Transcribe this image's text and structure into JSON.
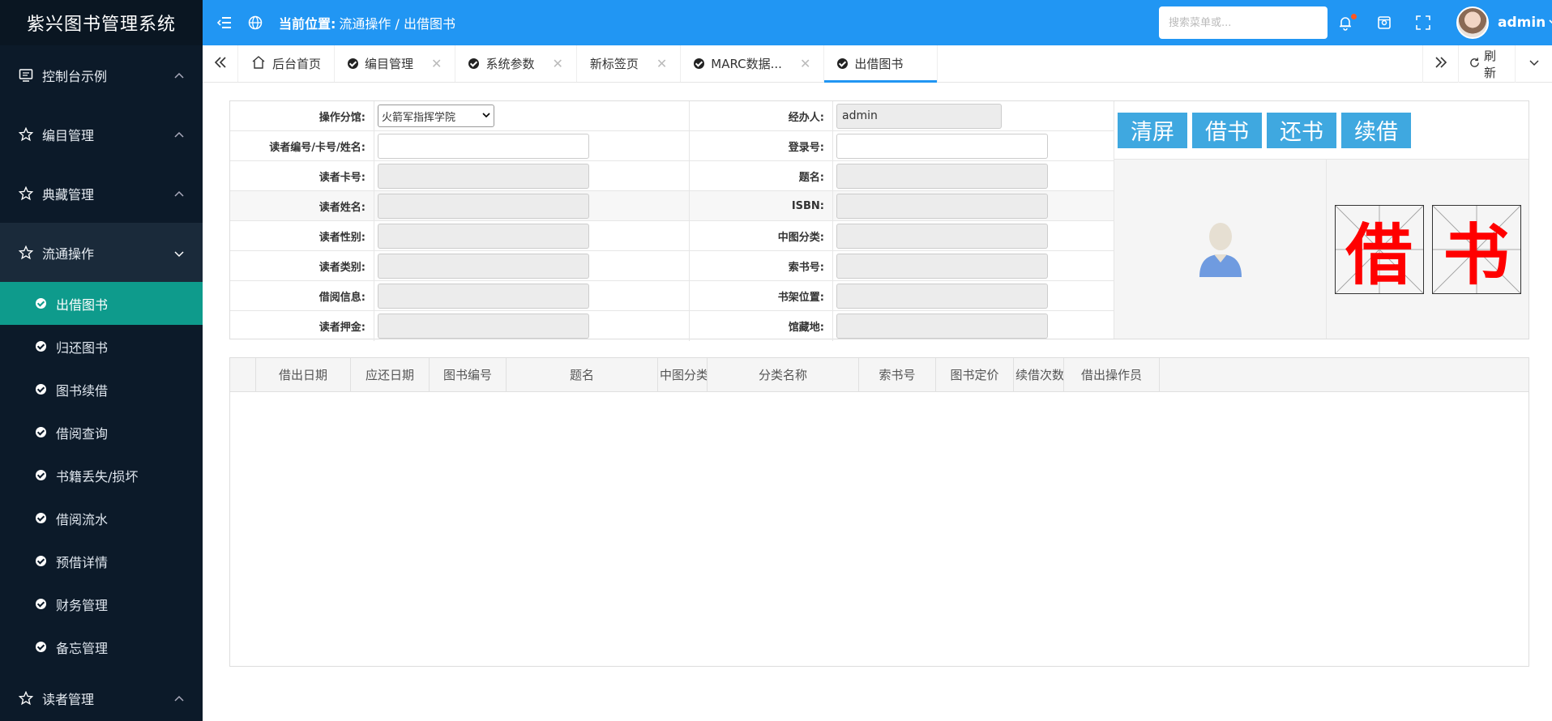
{
  "app": {
    "title": "紫兴图书管理系统"
  },
  "sidebar": {
    "groups_top": [
      {
        "label": "控制台示例"
      },
      {
        "label": "编目管理"
      },
      {
        "label": "典藏管理"
      },
      {
        "label": "流通操作"
      }
    ],
    "sub_items": [
      {
        "label": "出借图书"
      },
      {
        "label": "归还图书"
      },
      {
        "label": "图书续借"
      },
      {
        "label": "借阅查询"
      },
      {
        "label": "书籍丢失/损坏"
      },
      {
        "label": "借阅流水"
      },
      {
        "label": "预借详情"
      },
      {
        "label": "财务管理"
      },
      {
        "label": "备忘管理"
      }
    ],
    "group_bottom": {
      "label": "读者管理"
    }
  },
  "topbar": {
    "breadcrumb_label": "当前位置:",
    "breadcrumb_path": "流通操作 / 出借图书",
    "search_placeholder": "搜索菜单或...",
    "username": "admin"
  },
  "tabs": [
    {
      "label": "后台首页"
    },
    {
      "label": "编目管理"
    },
    {
      "label": "系统参数"
    },
    {
      "label": "新标签页"
    },
    {
      "label": "MARC数据..."
    },
    {
      "label": "出借图书"
    }
  ],
  "tab_controls": {
    "refresh": "刷新"
  },
  "form": {
    "branch_label": "操作分馆:",
    "branch_value": "火箭军指挥学院",
    "operator_label": "经办人:",
    "operator_value": "admin",
    "reader_search_label": "读者编号/卡号/姓名:",
    "login_no_label": "登录号:",
    "card_label": "读者卡号:",
    "title_label": "题名:",
    "name_label": "读者姓名:",
    "isbn_label": "ISBN:",
    "gender_label": "读者性别:",
    "clc_label": "中图分类:",
    "type_label": "读者类别:",
    "callno_label": "索书号:",
    "borrow_info_label": "借阅信息:",
    "shelf_label": "书架位置:",
    "deposit_label": "读者押金:",
    "location_label": "馆藏地:"
  },
  "buttons": {
    "clear": "清屏",
    "borrow": "借书",
    "return": "还书",
    "renew": "续借"
  },
  "stamp": {
    "char1": "借",
    "char2": "书"
  },
  "grid": {
    "columns": [
      "借出日期",
      "应还日期",
      "图书编号",
      "题名",
      "中图分类",
      "分类名称",
      "索书号",
      "图书定价",
      "续借次数",
      "借出操作员"
    ]
  }
}
